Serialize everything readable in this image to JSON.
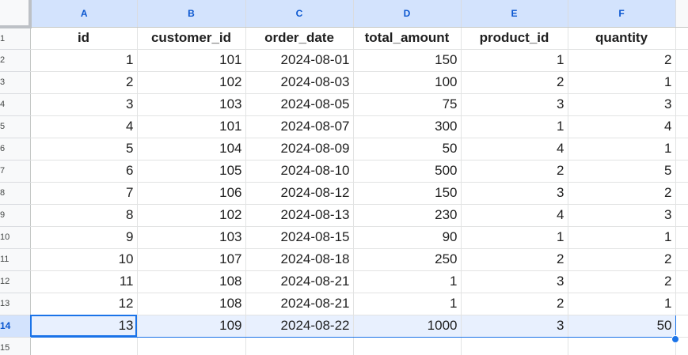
{
  "columns": [
    "A",
    "B",
    "C",
    "D",
    "E",
    "F"
  ],
  "header_row": {
    "row_number": "1",
    "values": [
      "id",
      "customer_id",
      "order_date",
      "total_amount",
      "product_id",
      "quantity"
    ]
  },
  "rows": [
    {
      "row_number": "2",
      "values": [
        "1",
        "101",
        "2024-08-01",
        "150",
        "1",
        "2"
      ]
    },
    {
      "row_number": "3",
      "values": [
        "2",
        "102",
        "2024-08-03",
        "100",
        "2",
        "1"
      ]
    },
    {
      "row_number": "4",
      "values": [
        "3",
        "103",
        "2024-08-05",
        "75",
        "3",
        "3"
      ]
    },
    {
      "row_number": "5",
      "values": [
        "4",
        "101",
        "2024-08-07",
        "300",
        "1",
        "4"
      ]
    },
    {
      "row_number": "6",
      "values": [
        "5",
        "104",
        "2024-08-09",
        "50",
        "4",
        "1"
      ]
    },
    {
      "row_number": "7",
      "values": [
        "6",
        "105",
        "2024-08-10",
        "500",
        "2",
        "5"
      ]
    },
    {
      "row_number": "8",
      "values": [
        "7",
        "106",
        "2024-08-12",
        "150",
        "3",
        "2"
      ]
    },
    {
      "row_number": "9",
      "values": [
        "8",
        "102",
        "2024-08-13",
        "230",
        "4",
        "3"
      ]
    },
    {
      "row_number": "10",
      "values": [
        "9",
        "103",
        "2024-08-15",
        "90",
        "1",
        "1"
      ]
    },
    {
      "row_number": "11",
      "values": [
        "10",
        "107",
        "2024-08-18",
        "250",
        "2",
        "2"
      ]
    },
    {
      "row_number": "12",
      "values": [
        "11",
        "108",
        "2024-08-21",
        "1",
        "3",
        "2"
      ]
    },
    {
      "row_number": "13",
      "values": [
        "12",
        "108",
        "2024-08-21",
        "1",
        "2",
        "1"
      ]
    },
    {
      "row_number": "14",
      "values": [
        "13",
        "109",
        "2024-08-22",
        "1000",
        "3",
        "50"
      ],
      "selected": true
    },
    {
      "row_number": "15",
      "values": [
        "",
        "",
        "",
        "",
        "",
        ""
      ]
    }
  ],
  "colors": {
    "selection": "#1a73e8",
    "selected_fill": "#e8f0fe",
    "header_selected": "#d3e3fd"
  }
}
